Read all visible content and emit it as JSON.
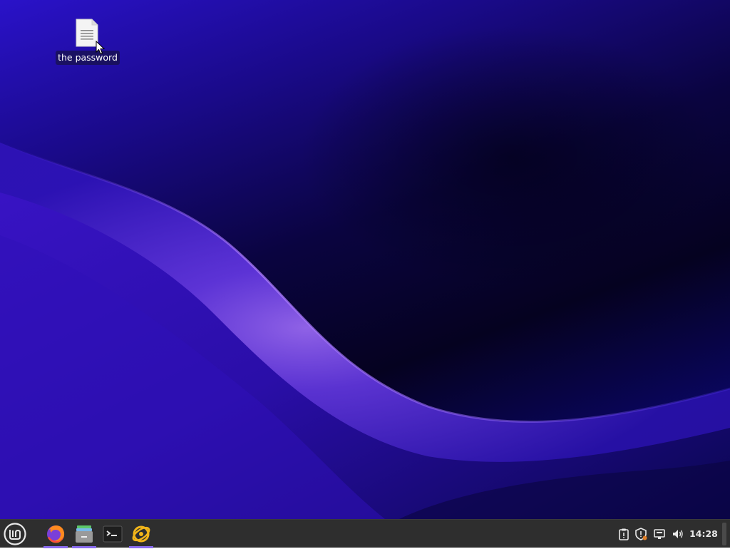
{
  "desktop": {
    "icons": [
      {
        "label": "the password",
        "icon": "text-file-icon"
      }
    ]
  },
  "panel": {
    "menu_icon": "linux-mint-menu-icon",
    "launchers": [
      {
        "icon": "firefox-icon",
        "active": true
      },
      {
        "icon": "file-manager-icon",
        "active": true
      },
      {
        "icon": "terminal-icon",
        "active": false
      },
      {
        "icon": "sync-app-icon",
        "active": true
      }
    ],
    "tray": [
      {
        "icon": "clipboard-icon"
      },
      {
        "icon": "update-shield-icon"
      },
      {
        "icon": "network-icon"
      },
      {
        "icon": "volume-icon"
      }
    ],
    "clock": "14:28"
  },
  "colors": {
    "panel_bg": "#2e2e2e",
    "active_indicator": "#8a6cf0"
  }
}
